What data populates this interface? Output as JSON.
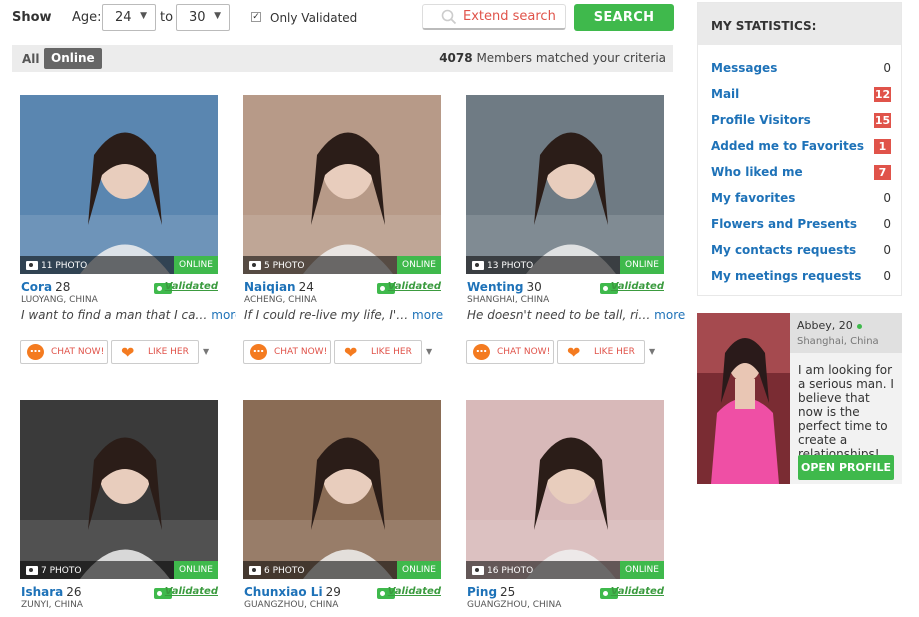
{
  "filters": {
    "show_label": "Show",
    "age_label": "Age:",
    "age_from": "24",
    "to_label": "to",
    "age_to": "30",
    "only_validated_label": "Only Validated",
    "only_validated_checked": true,
    "extend_search_label": "Extend search",
    "search_label": "SEARCH"
  },
  "tabs": {
    "all_label": "All",
    "online_label": "Online",
    "matched_count": "4078",
    "matched_text": "Members matched your criteria"
  },
  "profiles": [
    {
      "name": "Cora",
      "age": "28",
      "location": "LUOYANG, CHINA",
      "photo_count": "11 PHOTO",
      "status": "ONLINE",
      "validated": "Validated",
      "description": "I want to find a man that I ca…",
      "more": "more",
      "chat": "CHAT NOW!",
      "like": "LIKE HER",
      "photo_bg": "#5a86b0"
    },
    {
      "name": "Naiqian",
      "age": "24",
      "location": "ACHENG, CHINA",
      "photo_count": "5 PHOTO",
      "status": "ONLINE",
      "validated": "Validated",
      "description": "If I could re-live my life, I'…",
      "more": "more",
      "chat": "CHAT NOW!",
      "like": "LIKE HER",
      "photo_bg": "#b79a88"
    },
    {
      "name": "Wenting",
      "age": "30",
      "location": "SHANGHAI, CHINA",
      "photo_count": "13 PHOTO",
      "status": "ONLINE",
      "validated": "Validated",
      "description": "He doesn't need to be tall, ri…",
      "more": "more",
      "chat": "CHAT NOW!",
      "like": "LIKE HER",
      "photo_bg": "#6f7b84"
    },
    {
      "name": "Ishara",
      "age": "26",
      "location": "ZUNYI, CHINA",
      "photo_count": "7 PHOTO",
      "status": "ONLINE",
      "validated": "Validated",
      "photo_bg": "#3a3a3a"
    },
    {
      "name": "Chunxiao Li",
      "age": "29",
      "location": "GUANGZHOU, CHINA",
      "photo_count": "6 PHOTO",
      "status": "ONLINE",
      "validated": "Validated",
      "photo_bg": "#8a6c55"
    },
    {
      "name": "Ping",
      "age": "25",
      "location": "GUANGZHOU, CHINA",
      "photo_count": "16 PHOTO",
      "status": "ONLINE",
      "validated": "Validated",
      "photo_bg": "#d8b9b9"
    }
  ],
  "stats": {
    "title": "MY STATISTICS:",
    "items": [
      {
        "label": "Messages",
        "count": "0",
        "highlight": false
      },
      {
        "label": "Mail",
        "count": "12",
        "highlight": true
      },
      {
        "label": "Profile Visitors",
        "count": "15",
        "highlight": true
      },
      {
        "label": "Added me to Favorites",
        "count": "1",
        "highlight": true
      },
      {
        "label": "Who liked me",
        "count": "7",
        "highlight": true
      },
      {
        "label": "My favorites",
        "count": "0",
        "highlight": false
      },
      {
        "label": "Flowers and Presents",
        "count": "0",
        "highlight": false
      },
      {
        "label": "My contacts requests",
        "count": "0",
        "highlight": false
      },
      {
        "label": "My meetings requests",
        "count": "0",
        "highlight": false
      }
    ]
  },
  "promo": {
    "name_age": "Abbey, 20",
    "location": "Shanghai, China",
    "text": "I am looking for a serious man. I believe that now is the perfect time to create a relationships!",
    "button": "OPEN PROFILE"
  },
  "colors": {
    "accent_green": "#3fb94c",
    "link_blue": "#1e72b8",
    "badge_red": "#e0534a",
    "button_orange": "#f47b20"
  }
}
